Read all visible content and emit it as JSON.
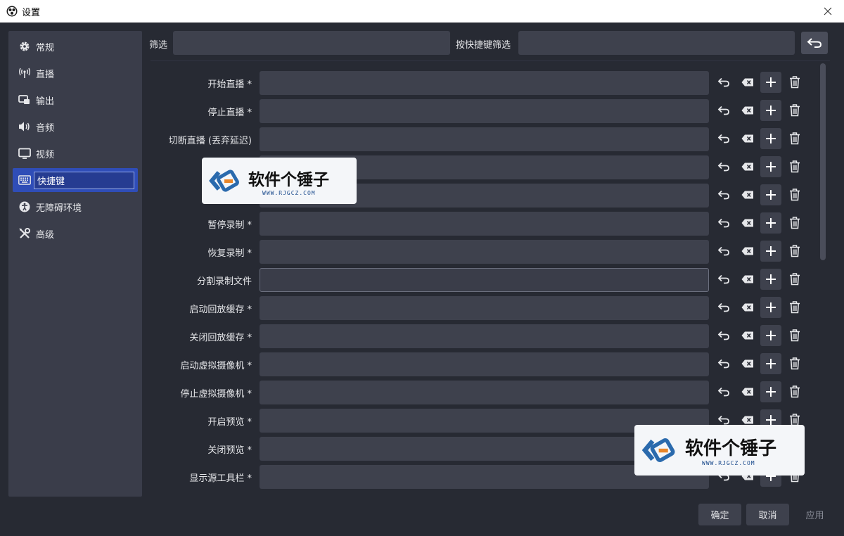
{
  "window": {
    "title": "设置"
  },
  "sidebar": {
    "items": [
      {
        "label": "常规",
        "icon": "gear-icon"
      },
      {
        "label": "直播",
        "icon": "broadcast-icon"
      },
      {
        "label": "输出",
        "icon": "output-icon"
      },
      {
        "label": "音频",
        "icon": "speaker-icon"
      },
      {
        "label": "视频",
        "icon": "monitor-icon"
      },
      {
        "label": "快捷键",
        "icon": "keyboard-icon",
        "active": true
      },
      {
        "label": "无障碍环境",
        "icon": "accessibility-icon"
      },
      {
        "label": "高级",
        "icon": "tools-icon"
      }
    ]
  },
  "filters": {
    "filter_label": "筛选",
    "filter_value": "",
    "hotkey_filter_label": "按快捷键筛选",
    "hotkey_filter_value": ""
  },
  "hotkeys": {
    "rows": [
      {
        "label": "开始直播 *",
        "value": ""
      },
      {
        "label": "停止直播 *",
        "value": ""
      },
      {
        "label": "切断直播 (丢弃延迟)",
        "value": ""
      },
      {
        "label": "",
        "value": ""
      },
      {
        "label": "",
        "value": ""
      },
      {
        "label": "暂停录制 *",
        "value": ""
      },
      {
        "label": "恢复录制 *",
        "value": ""
      },
      {
        "label": "分割录制文件",
        "value": "",
        "focused": true
      },
      {
        "label": "启动回放缓存 *",
        "value": ""
      },
      {
        "label": "关闭回放缓存 *",
        "value": ""
      },
      {
        "label": "启动虚拟摄像机 *",
        "value": ""
      },
      {
        "label": "停止虚拟摄像机 *",
        "value": ""
      },
      {
        "label": "开启预览 *",
        "value": ""
      },
      {
        "label": "关闭预览 *",
        "value": ""
      },
      {
        "label": "显示源工具栏 *",
        "value": ""
      }
    ]
  },
  "buttons": {
    "ok": "确定",
    "cancel": "取消",
    "apply": "应用"
  },
  "watermark": {
    "title": "软件个锤子",
    "subtitle": "WWW.RJGCZ.COM"
  },
  "colors": {
    "accent": "#2f4db7",
    "background": "#272a33",
    "panel": "#3a3d4a",
    "input": "#3e414d"
  }
}
